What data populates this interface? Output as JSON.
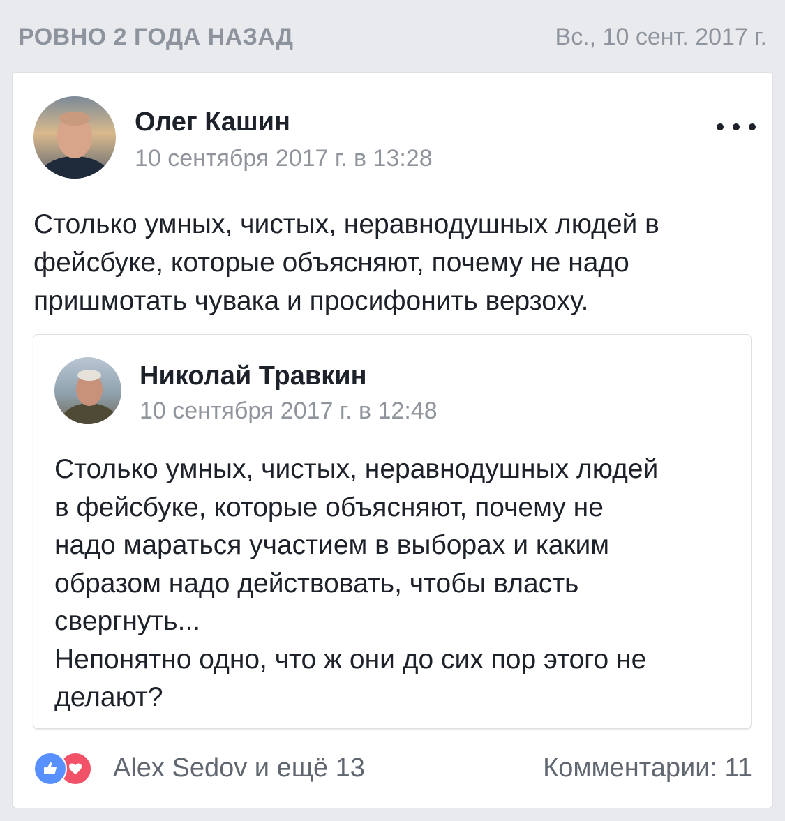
{
  "memory": {
    "label": "РОВНО 2 ГОДА НАЗАД",
    "date": "Вс., 10 сент. 2017 г."
  },
  "post": {
    "author": "Олег Кашин",
    "time": "10 сентября 2017 г. в 13:28",
    "text": "Столько умных, чистых, неравнодушных людей в\nфейсбуке, которые объясняют, почему не надо\nпришмотать чувака и просифонить верзоху."
  },
  "shared_post": {
    "author": "Николай Травкин",
    "time": "10 сентября 2017 г. в 12:48",
    "text": "Столько умных, чистых, неравнодушных людей\nв фейсбуке, которые объясняют, почему не\nнадо мараться участием в выборах и каким\nобразом надо действовать, чтобы власть\nсвергнуть...\nНепонятно одно, что ж они до сих пор этого не\nделают?"
  },
  "footer": {
    "reactors": "Alex Sedov и ещё 13",
    "comments": "Комментарии: 11"
  },
  "icons": {
    "reaction_like": "like-icon",
    "reaction_love": "love-icon",
    "more": "more-options-icon"
  },
  "colors": {
    "like": "#5890ff",
    "love": "#f25268",
    "meta_text": "#90949c"
  }
}
